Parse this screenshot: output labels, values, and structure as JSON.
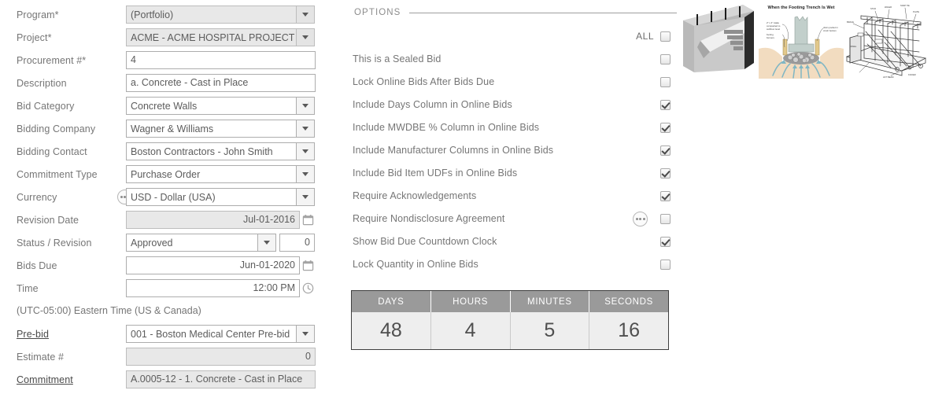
{
  "form": {
    "fields": [
      {
        "label": "Program*",
        "type": "select",
        "value": "(Portfolio)",
        "disabled": true,
        "link": false
      },
      {
        "label": "Project*",
        "type": "select",
        "value": "ACME - ACME HOSPITAL PROJECT",
        "disabled": true,
        "link": false
      },
      {
        "label": "Procurement #*",
        "type": "text",
        "value": "4",
        "disabled": false,
        "link": false
      },
      {
        "label": "Description",
        "type": "text",
        "value": "a. Concrete - Cast in Place",
        "disabled": false,
        "link": false
      },
      {
        "label": "Bid Category",
        "type": "select",
        "value": "Concrete Walls",
        "disabled": false,
        "link": false
      },
      {
        "label": "Bidding Company",
        "type": "select",
        "value": "Wagner & Williams",
        "disabled": false,
        "link": false
      },
      {
        "label": "Bidding Contact",
        "type": "select",
        "value": "Boston Contractors - John Smith",
        "disabled": false,
        "link": false
      },
      {
        "label": "Commitment Type",
        "type": "select",
        "value": "Purchase Order",
        "disabled": false,
        "link": false
      },
      {
        "label": "Currency",
        "type": "select",
        "value": "USD - Dollar (USA)",
        "disabled": false,
        "link": false,
        "dots": true
      },
      {
        "label": "Revision Date",
        "type": "date",
        "value": "Jul-01-2016",
        "disabled": true,
        "link": false
      },
      {
        "label": "Status / Revision",
        "type": "status",
        "value": "Approved",
        "revision": "0",
        "disabled": false,
        "link": false
      },
      {
        "label": "Bids Due",
        "type": "date",
        "value": "Jun-01-2020",
        "disabled": false,
        "link": false
      },
      {
        "label": "Time",
        "type": "time",
        "value": "12:00 PM",
        "disabled": false,
        "link": false
      },
      {
        "label": "Pre-bid",
        "type": "select",
        "value": "001 - Boston Medical Center Pre-bid",
        "disabled": false,
        "link": true
      },
      {
        "label": "Estimate #",
        "type": "number",
        "value": "0",
        "disabled": true,
        "link": false
      },
      {
        "label": "Commitment",
        "type": "textgrey",
        "value": "A.0005-12 - 1. Concrete - Cast in Place",
        "disabled": true,
        "link": true
      }
    ],
    "timezone": "(UTC-05:00) Eastern Time (US & Canada)"
  },
  "options": {
    "title": "OPTIONS",
    "all_label": "ALL",
    "all_checked": false,
    "items": [
      {
        "label": "This is a Sealed Bid",
        "checked": false,
        "dots": false
      },
      {
        "label": "Lock Online Bids After Bids Due",
        "checked": false,
        "dots": false
      },
      {
        "label": "Include Days Column in Online Bids",
        "checked": true,
        "dots": false
      },
      {
        "label": "Include MWDBE % Column in Online Bids",
        "checked": true,
        "dots": false
      },
      {
        "label": "Include Manufacturer Columns in Online Bids",
        "checked": true,
        "dots": false
      },
      {
        "label": "Include Bid Item UDFs in Online Bids",
        "checked": true,
        "dots": false
      },
      {
        "label": "Require Acknowledgements",
        "checked": true,
        "dots": false
      },
      {
        "label": "Require Nondisclosure Agreement",
        "checked": false,
        "dots": true
      },
      {
        "label": "Show Bid Due Countdown Clock",
        "checked": true,
        "dots": false
      },
      {
        "label": "Lock Quantity in Online Bids",
        "checked": false,
        "dots": false
      }
    ]
  },
  "countdown": {
    "headers": [
      "DAYS",
      "HOURS",
      "MINUTES",
      "SECONDS"
    ],
    "values": [
      "48",
      "4",
      "5",
      "16"
    ]
  },
  "thumbnails": [
    {
      "name": "concrete-wall-section-diagram",
      "caption": ""
    },
    {
      "name": "wet-footing-trench-diagram",
      "caption": "When the Footing Trench Is Wet"
    },
    {
      "name": "wall-formwork-scaffolding-diagram",
      "caption": ""
    }
  ],
  "colors": {
    "label_text": "#767676",
    "value_text": "#5c5c5c",
    "field_border": "#adadad",
    "disabled_bg": "#e8e8e8",
    "countdown_header_bg": "#9a9a9a",
    "countdown_cell_bg": "#eeeeee"
  }
}
